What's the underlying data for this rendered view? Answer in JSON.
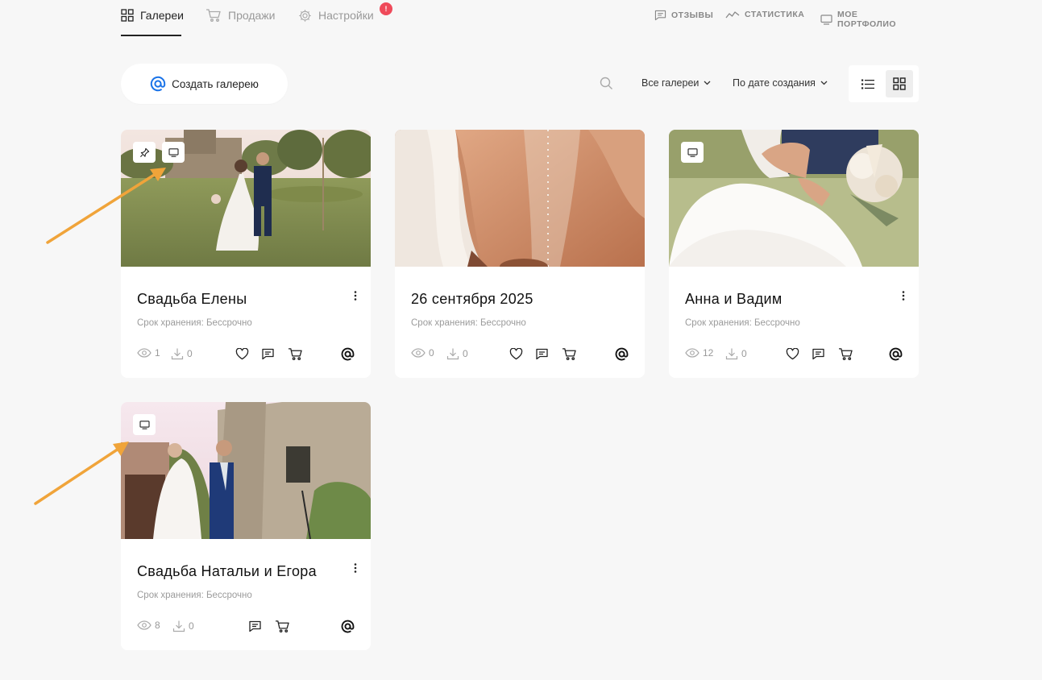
{
  "nav": {
    "tabs": [
      {
        "label": "Галереи",
        "icon": "grid-icon",
        "active": true
      },
      {
        "label": "Продажи",
        "icon": "cart-icon",
        "active": false
      },
      {
        "label": "Настройки",
        "icon": "gear-icon",
        "active": false,
        "badge": "!"
      }
    ],
    "links": [
      {
        "label": "ОТЗЫВЫ",
        "icon": "comment-icon"
      },
      {
        "label": "СТАТИСТИКА",
        "icon": "stats-icon"
      },
      {
        "label": "МОЕ ПОРТФОЛИО",
        "icon": "monitor-icon"
      }
    ]
  },
  "toolbar": {
    "create_label": "Создать галерею",
    "filter_label": "Все галереи",
    "sort_label": "По дате создания",
    "view_mode": "grid"
  },
  "galleries": [
    {
      "title": "Свадьба Елены",
      "storage": "Срок хранения: Бессрочно",
      "views": "1",
      "downloads": "0",
      "pinned": true,
      "portfolio": true,
      "actions": [
        "heart-icon",
        "comment-icon",
        "cart-icon"
      ]
    },
    {
      "title": "26 сентября 2025",
      "storage": "Срок хранения: Бессрочно",
      "views": "0",
      "downloads": "0",
      "pinned": false,
      "portfolio": false,
      "actions": [
        "heart-icon",
        "comment-icon",
        "cart-icon"
      ]
    },
    {
      "title": "Анна и Вадим",
      "storage": "Срок хранения: Бессрочно",
      "views": "12",
      "downloads": "0",
      "pinned": false,
      "portfolio": true,
      "actions": [
        "heart-icon",
        "comment-icon",
        "cart-icon"
      ]
    },
    {
      "title": "Свадьба Натальи и Егора",
      "storage": "Срок хранения: Бессрочно",
      "views": "8",
      "downloads": "0",
      "pinned": false,
      "portfolio": true,
      "actions": [
        "comment-icon",
        "cart-icon"
      ]
    }
  ],
  "colors": {
    "background": "#f7f7f7",
    "card": "#ffffff",
    "badge": "#ef4a5a",
    "accent_blue": "#1a73e8",
    "annotation_arrow": "#f0a43a"
  }
}
